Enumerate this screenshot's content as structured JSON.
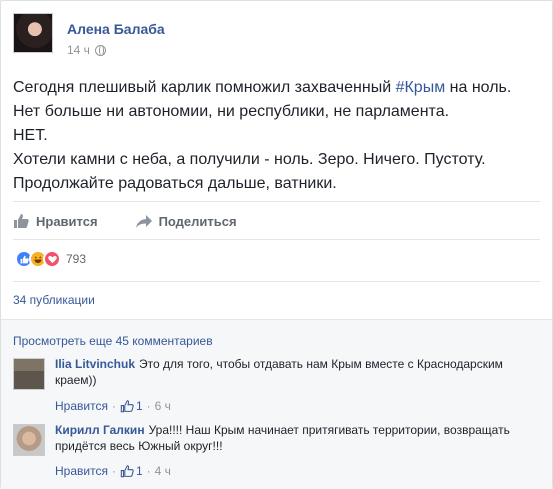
{
  "post": {
    "author": "Алена Балаба",
    "time": "14 ч",
    "lines": [
      {
        "before": "Сегодня плешивый карлик помножил захваченный ",
        "hashtag": "#Крым",
        "after": " на ноль."
      },
      {
        "before": "Нет больше ни автономии, ни республики, не парламента.",
        "hashtag": "",
        "after": ""
      },
      {
        "before": "НЕТ.",
        "hashtag": "",
        "after": ""
      },
      {
        "before": "Хотели камни с неба, а получили - ноль. Зеро. Ничего. Пустоту.",
        "hashtag": "",
        "after": ""
      },
      {
        "before": "Продолжайте радоваться дальше, ватники.",
        "hashtag": "",
        "after": ""
      }
    ]
  },
  "actions": {
    "like_label": "Нравится",
    "share_label": "Поделиться"
  },
  "reactions": {
    "count": "793",
    "types": [
      "like-icon",
      "haha-icon",
      "love-icon"
    ]
  },
  "shares_label": "34 публикации",
  "comments": {
    "view_more": "Просмотреть еще 45 комментариев",
    "items": [
      {
        "author": "Ilia Litvinchuk",
        "text": "Это для того, чтобы отдавать нам Крым вместе с Краснодарским краем))",
        "like_label": "Нравится",
        "likes": "1",
        "time": "6 ч"
      },
      {
        "author": "Кирилл Галкин",
        "text": "Ура!!!! Наш Крым начинает притягивать территории, возвращать придётся весь Южный округ!!!",
        "like_label": "Нравится",
        "likes": "1",
        "time": "4 ч"
      }
    ]
  },
  "colors": {
    "link": "#365899",
    "text": "#1d2129",
    "muted": "#90949c",
    "like_reaction": "#4080ff",
    "love_reaction": "#f25268",
    "haha_reaction": "#f7b125"
  }
}
